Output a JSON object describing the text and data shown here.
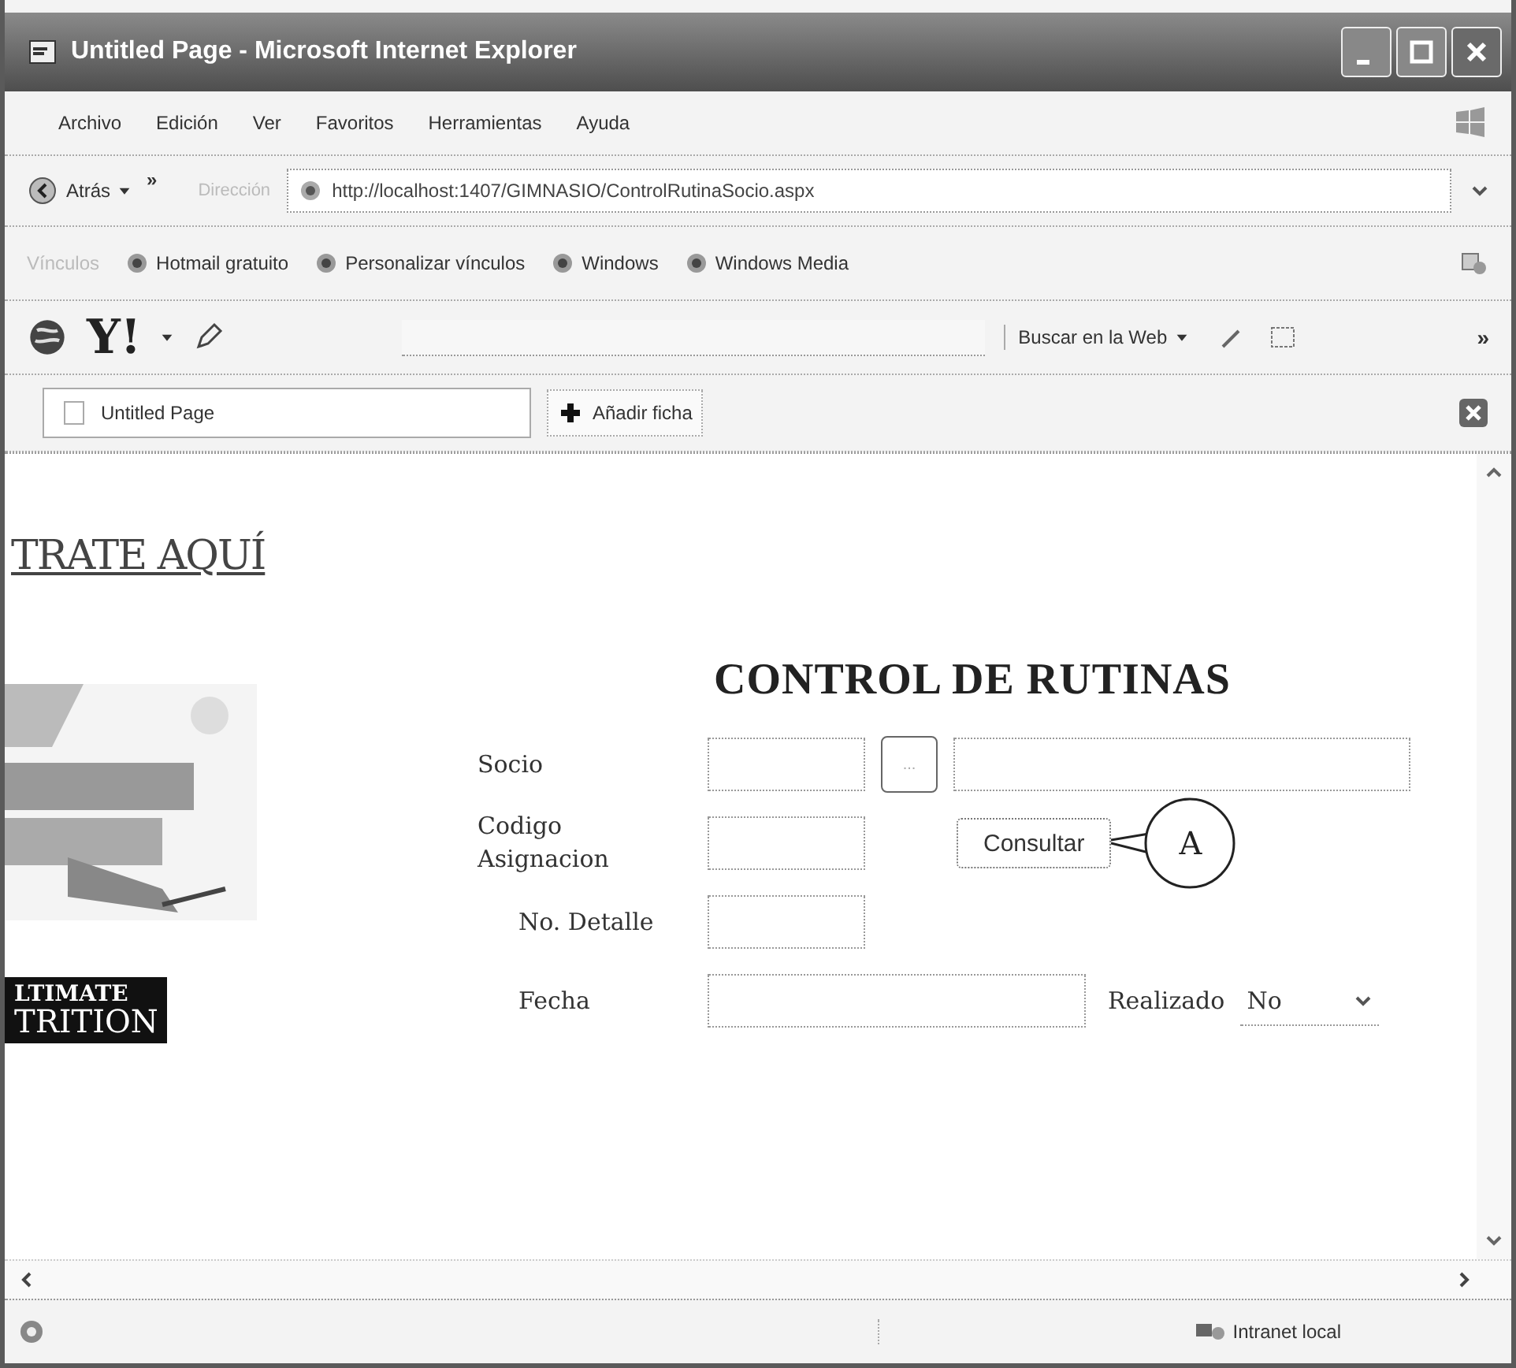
{
  "window": {
    "title": "Untitled Page - Microsoft Internet Explorer"
  },
  "menu": [
    "Archivo",
    "Edición",
    "Ver",
    "Favoritos",
    "Herramientas",
    "Ayuda"
  ],
  "nav": {
    "back": "Atrás",
    "more": "»",
    "address_label": "Dirección",
    "address": "http://localhost:1407/GIMNASIO/ControlRutinaSocio.aspx"
  },
  "links": {
    "label": "Vínculos",
    "items": [
      "Hotmail gratuito",
      "Personalizar vínculos",
      "Windows",
      "Windows Media"
    ]
  },
  "search_toolbar": {
    "logo": "Y!",
    "search_button": "Buscar en la Web",
    "more": "»"
  },
  "tabs": [
    {
      "label": "Untitled Page",
      "selected": true
    }
  ],
  "new_tab": "Añadir ficha",
  "sidebar": {
    "link": "TRATE AQUÍ",
    "logo_lines": [
      "LTIMATE",
      "TRITION"
    ]
  },
  "form": {
    "title": "CONTROL DE RUTINAS",
    "socio_label": "Socio",
    "socio_button": "...",
    "codigo_label": "Codigo Asignacion",
    "consultar": "Consultar",
    "detalle_label": "No. Detalle",
    "fecha_label": "Fecha",
    "realizado_label": "Realizado",
    "realizado_value": "No"
  },
  "callout": "A",
  "status": {
    "zone": "Intranet local"
  }
}
